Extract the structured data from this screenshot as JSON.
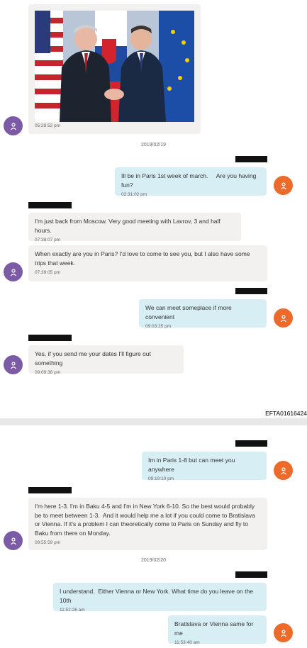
{
  "doc_id": "EFTA01616424",
  "photo_message": {
    "time": "05:28:52 pm"
  },
  "dates": [
    "2019/02/19",
    "2019/02/20"
  ],
  "messages": [
    {
      "dir": "out",
      "text": "Ill be in Paris 1st week of march.     Are you having fun?",
      "time": "02:31:02 pm"
    },
    {
      "dir": "in",
      "text": "I'm just back from Moscow. Very good meeting with Lavrov, 3 and half hours.",
      "time": "07:38:07 pm"
    },
    {
      "dir": "in",
      "text": "When exactly are you in Paris? I'd love to come to see you, but I also have some trips that week.",
      "time": "07:39:05 pm"
    },
    {
      "dir": "out",
      "text": "We can meet someplace if more convenient",
      "time": "09:03:25 pm"
    },
    {
      "dir": "in",
      "text": "Yes, if you send me your dates I'll figure out something",
      "time": "09:09:38 pm"
    },
    {
      "dir": "out",
      "text": "Im in Paris 1-8 but can meet you anywhere",
      "time": "09:19:10 pm"
    },
    {
      "dir": "in",
      "text": "I'm here 1-3. I'm in Baku 4-5 and I'm in New York 6-10. So the best would probably be to meet between 1-3.  And it would help me a lot if you could come to Bratislava or Vienna. If it's a problem I can theoretically come to Paris on Sunday and fly to Baku from there on Monday.",
      "time": "09:55:59 pm"
    },
    {
      "dir": "out",
      "text": "I understand.  Either Vienna or New York. What time do you leave on the 10th",
      "time": "11:52:26 am"
    },
    {
      "dir": "out",
      "text": "Bratlslava or Vienna same for me",
      "time": "11:53:40 am"
    }
  ],
  "colors": {
    "incoming": "#f2f1ef",
    "outgoing": "#d7eef5",
    "avatar_in": "#7b5aa6",
    "avatar_out": "#ec6a2a"
  }
}
